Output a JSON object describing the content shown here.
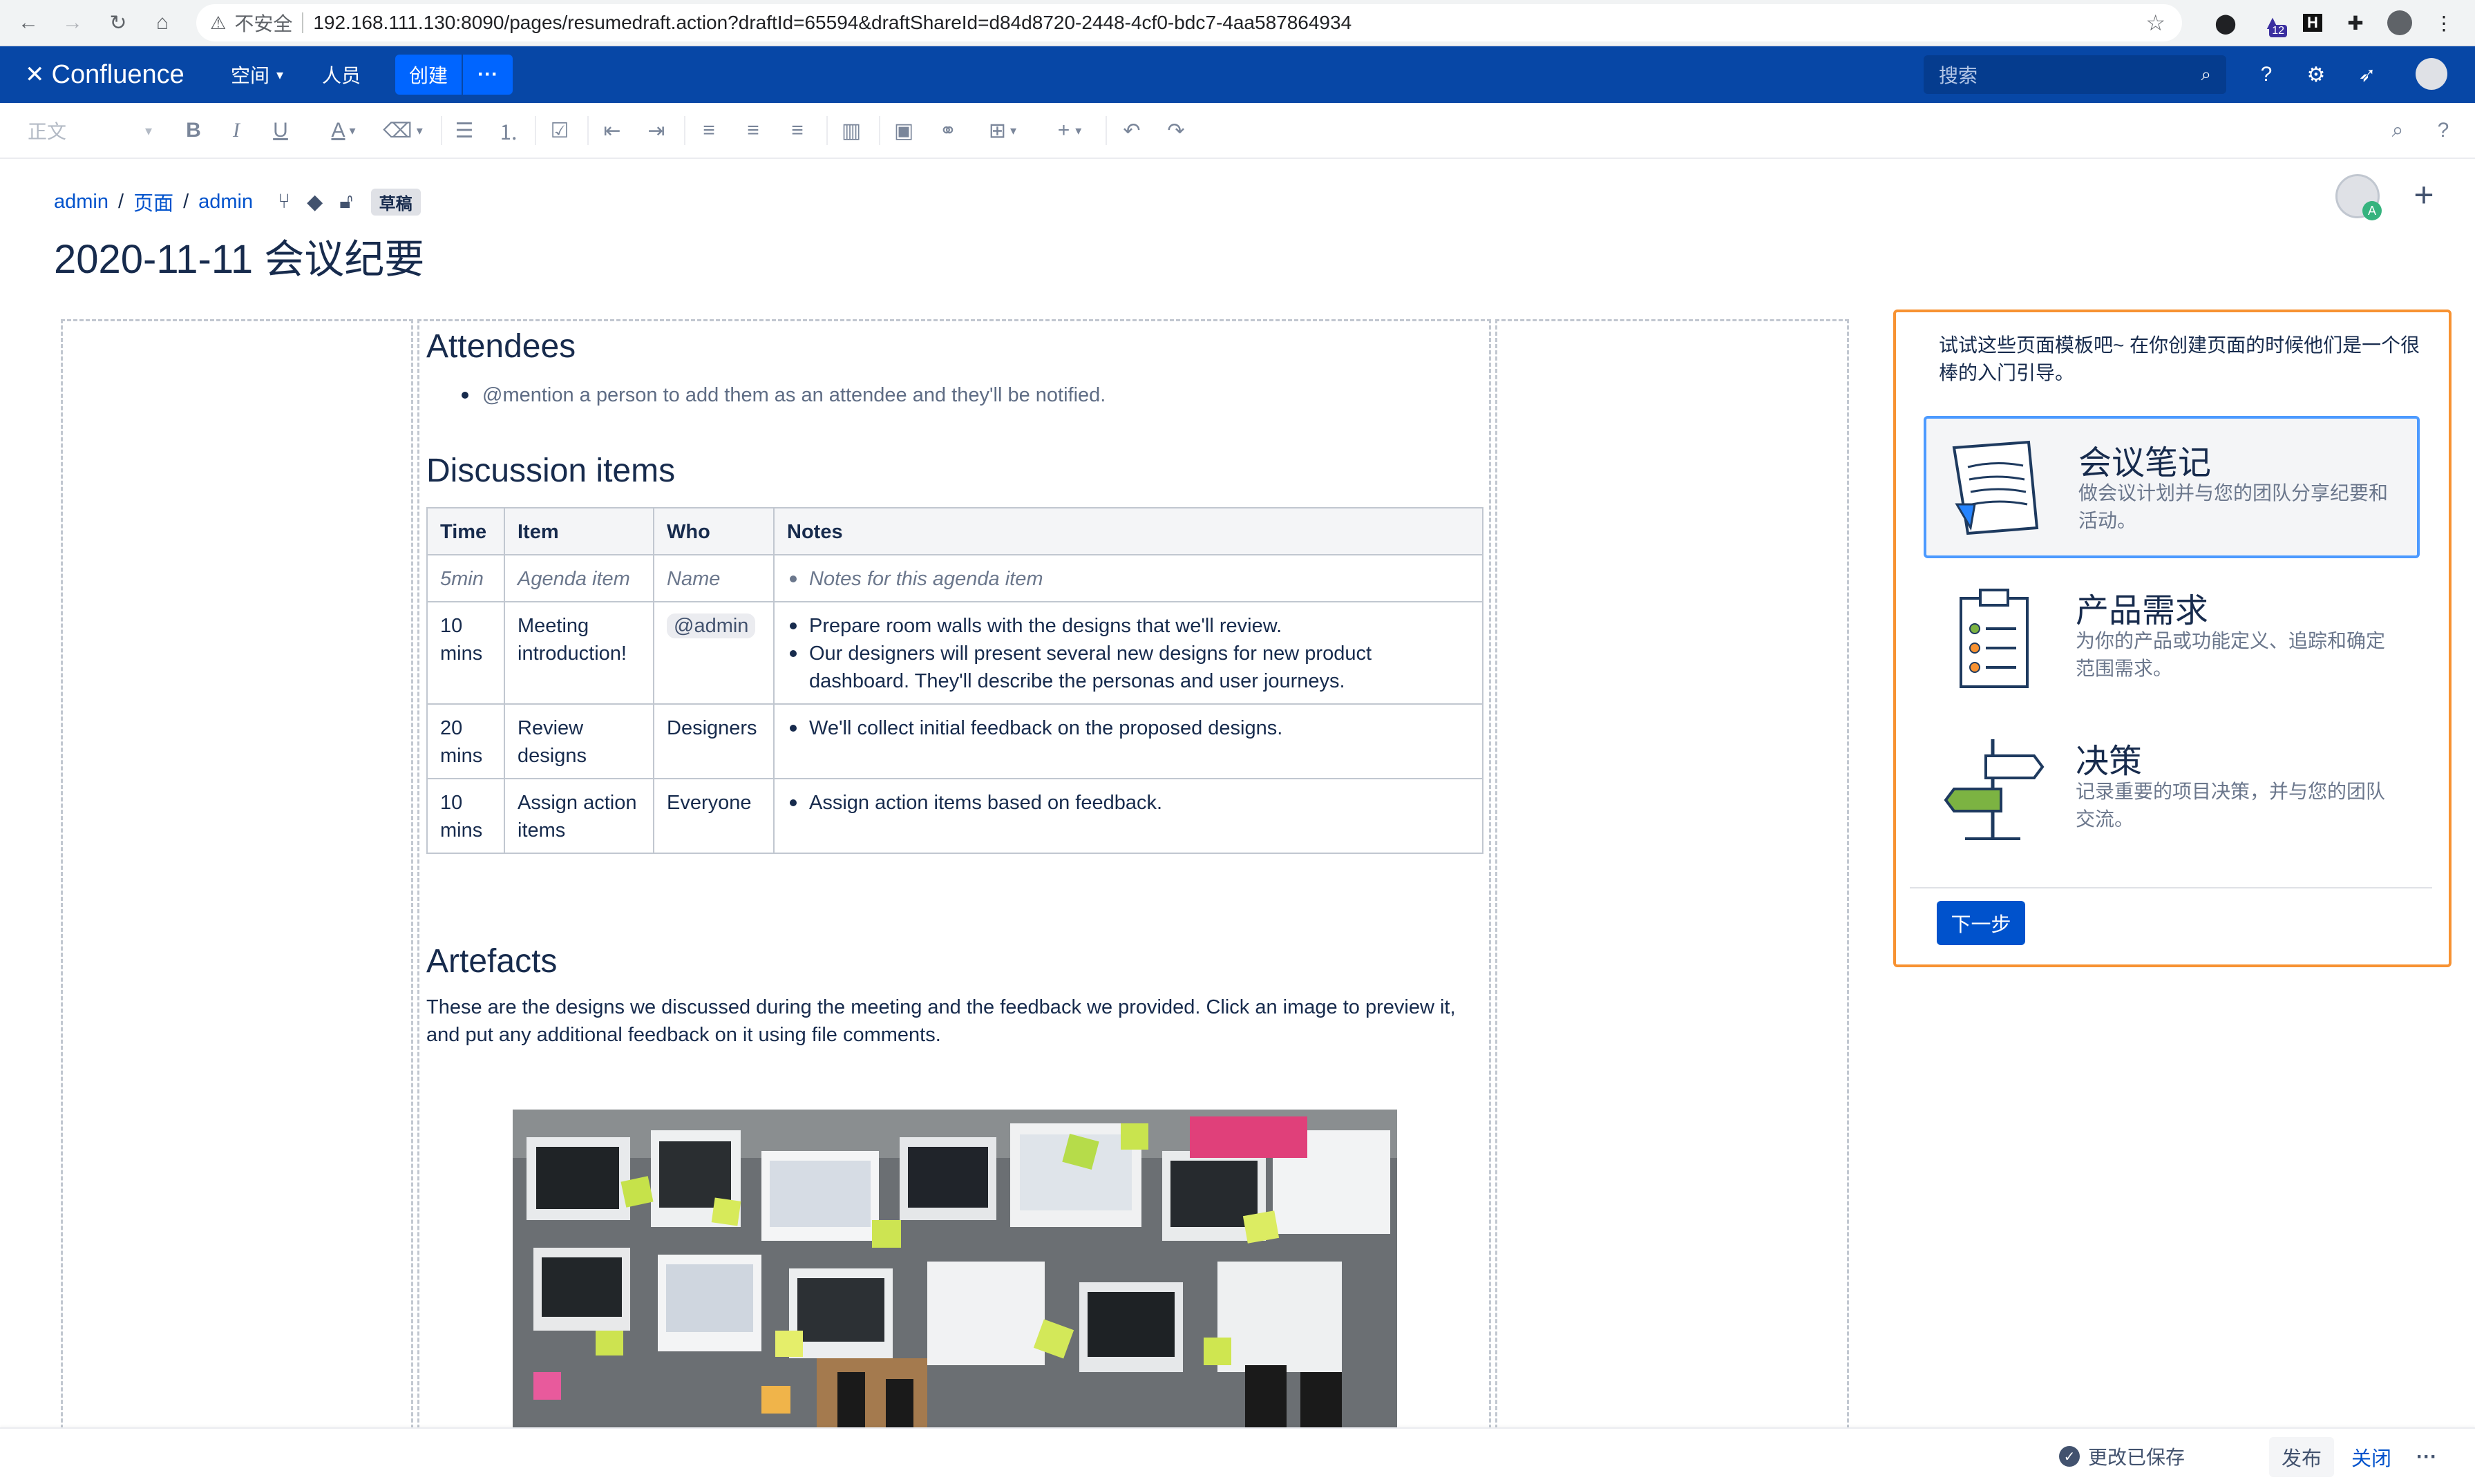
{
  "browser": {
    "insecure_label": "不安全",
    "url": "192.168.111.130:8090/pages/resumedraft.action?draftId=65594&draftShareId=d84d8720-2448-4cf0-bdc7-4aa587864934",
    "ext_badge": "12"
  },
  "header": {
    "logo": "Confluence",
    "spaces": "空间",
    "people": "人员",
    "create": "创建",
    "more": "···",
    "search_placeholder": "搜索"
  },
  "toolbar": {
    "style_select": "正文"
  },
  "breadcrumb": {
    "items": [
      "admin",
      "页面",
      "admin"
    ],
    "draft_badge": "草稿"
  },
  "page": {
    "title": "2020-11-11 会议纪要",
    "avatar_badge": "A"
  },
  "content": {
    "attendees_heading": "Attendees",
    "attendees_hint": "@mention a person to add them as an attendee and they'll be notified.",
    "discussion_heading": "Discussion items",
    "table": {
      "headers": [
        "Time",
        "Item",
        "Who",
        "Notes"
      ],
      "rows": [
        {
          "time": "5min",
          "item": "Agenda item",
          "who": "Name",
          "notes": [
            "Notes for this agenda item"
          ]
        },
        {
          "time": "10 mins",
          "item": "Meeting introduction!",
          "who": "@admin",
          "notes": [
            "Prepare room walls with the designs that we'll review.",
            "Our designers will present several new designs for new product dashboard. They'll describe the personas and user journeys."
          ]
        },
        {
          "time": "20 mins",
          "item": "Review designs",
          "who": "Designers",
          "notes": [
            "We'll collect initial feedback on the proposed designs."
          ]
        },
        {
          "time": "10 mins",
          "item": "Assign action items",
          "who": "Everyone",
          "notes": [
            "Assign action items based on feedback."
          ]
        }
      ]
    },
    "artefacts_heading": "Artefacts",
    "artefacts_text": "These are the designs we discussed during the meeting and the feedback we provided. Click an image to preview it, and put any additional feedback on it using file comments."
  },
  "templates": {
    "intro": "试试这些页面模板吧~ 在你创建页面的时候他们是一个很棒的入门引导。",
    "items": [
      {
        "name": "会议笔记",
        "desc": "做会议计划并与您的团队分享纪要和活动。"
      },
      {
        "name": "产品需求",
        "desc": "为你的产品或功能定义、追踪和确定范围需求。"
      },
      {
        "name": "决策",
        "desc": "记录重要的项目决策，并与您的团队交流。"
      }
    ],
    "next": "下一步"
  },
  "footer": {
    "saved": "更改已保存",
    "publish": "发布",
    "close": "关闭",
    "more": "···"
  },
  "colors": {
    "header_bg": "#0747a6",
    "create_btn": "#0065ff",
    "link": "#0052cc",
    "panel_border": "#f79232",
    "selected_template": "#4c9aff"
  }
}
